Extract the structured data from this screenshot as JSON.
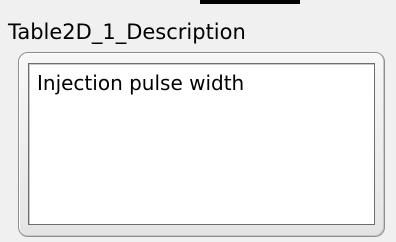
{
  "control": {
    "label": "Table2D_1_Description",
    "value": "Injection pulse width"
  }
}
